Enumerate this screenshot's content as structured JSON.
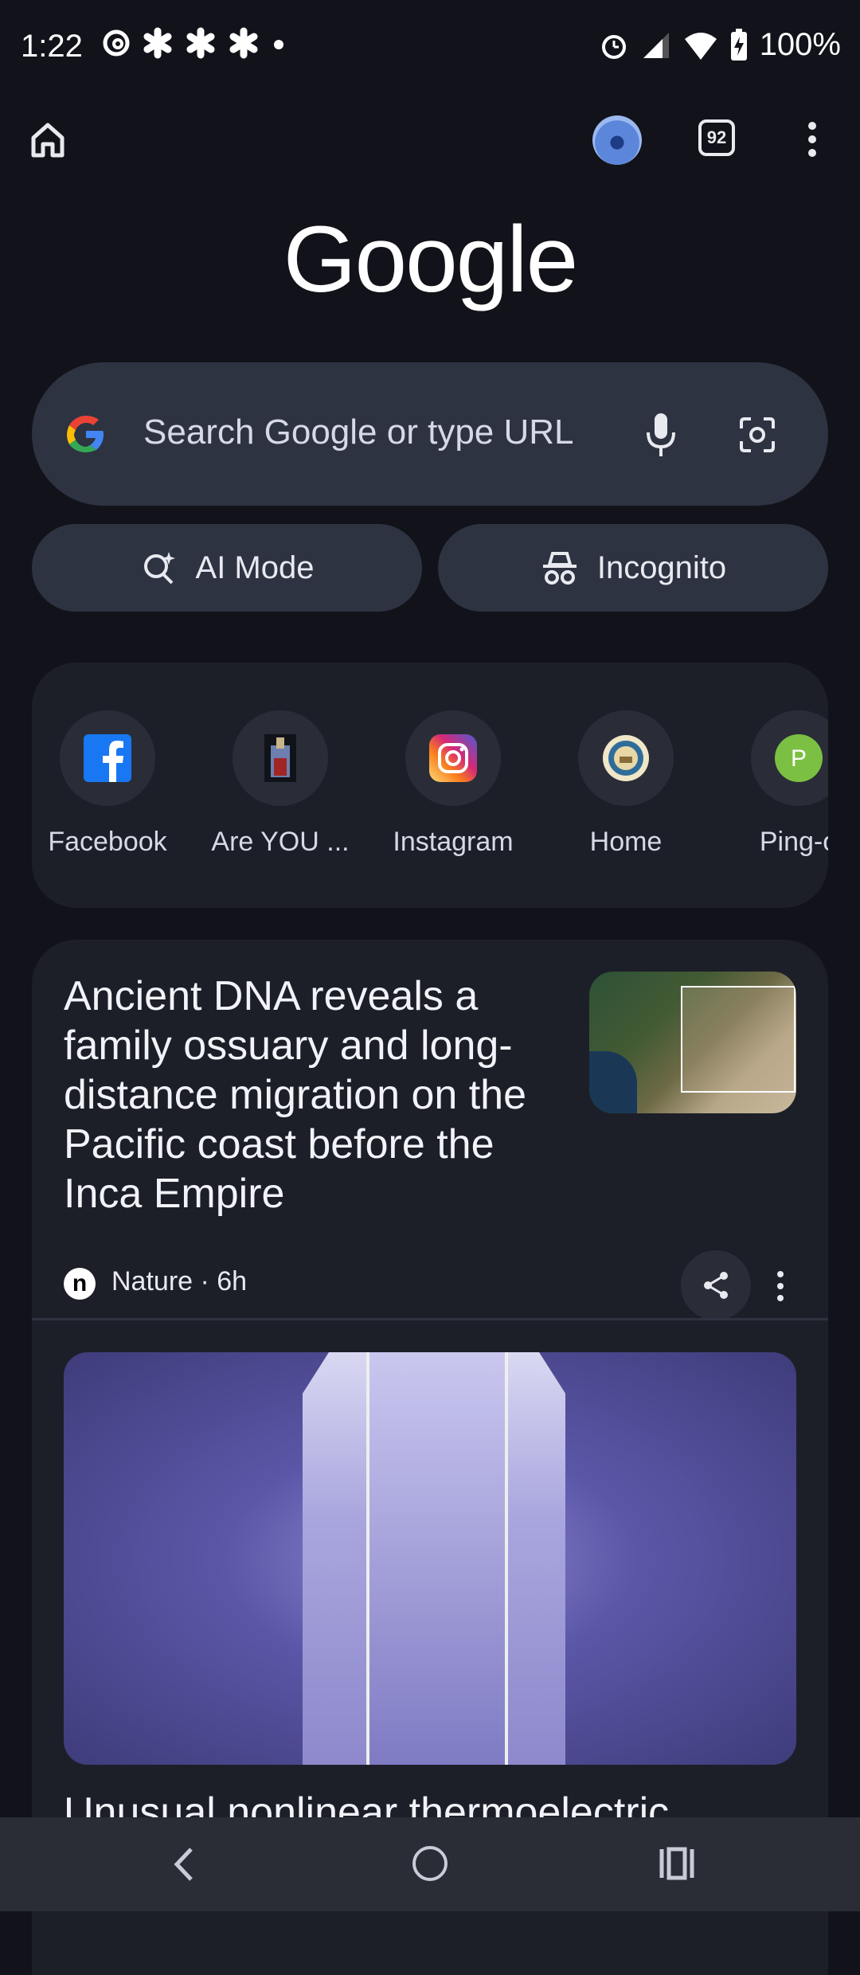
{
  "status_bar": {
    "time": "1:22",
    "battery": "100%"
  },
  "toolbar": {
    "tab_count": "92"
  },
  "logo_text": "Google",
  "search": {
    "placeholder": "Search Google or type URL"
  },
  "buttons": {
    "ai_mode": "AI Mode",
    "incognito": "Incognito"
  },
  "shortcuts": [
    {
      "label": "Facebook",
      "icon": "facebook-icon"
    },
    {
      "label": "Are YOU ...",
      "icon": "building-thumbnail-icon"
    },
    {
      "label": "Instagram",
      "icon": "instagram-icon"
    },
    {
      "label": "Home",
      "icon": "seal-icon"
    },
    {
      "label": "Ping-o",
      "icon": "letter-p-icon"
    }
  ],
  "feed": {
    "card1": {
      "headline": "Ancient DNA reveals a family ossuary and long-distance migration on the Pacific coast before the Inca Empire",
      "source_logo": "n",
      "source": "Nature · 6h"
    },
    "card2": {
      "headline": "Unusual nonlinear thermoelectric"
    }
  },
  "colors": {
    "background": "#12131a",
    "surface": "#1d1f28",
    "search_fill": "#2e3342",
    "facebook_blue": "#1877f2",
    "instagram_gradient": "#e1306c"
  }
}
